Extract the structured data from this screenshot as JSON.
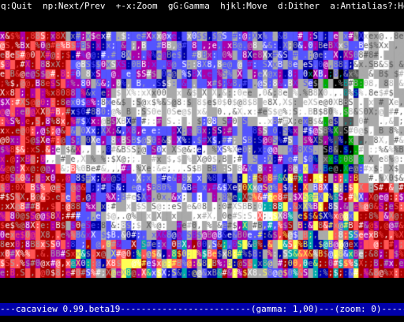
{
  "app": {
    "name": "cacaview"
  },
  "topbar": {
    "items": [
      {
        "key": "q",
        "label": "Quit"
      },
      {
        "key": "np",
        "label": "Next/Prev"
      },
      {
        "key": "+-x",
        "label": "Zoom"
      },
      {
        "key": "gG",
        "label": "Gamma"
      },
      {
        "key": "hjkl",
        "label": "Move"
      },
      {
        "key": "d",
        "label": "Dither"
      },
      {
        "key": "a",
        "label": "Antialias"
      },
      {
        "key": "?",
        "label": "Help"
      }
    ],
    "text": "q:Quit  np:Next/Prev  +-x:Zoom  gG:Gamma  hjkl:Move  d:Dither  a:Antialias?:Help"
  },
  "statusbar": {
    "text": "---cacaview 0.99.beta19-------------------------(gamma: 1,00)---(zoom: 0)-----"
  },
  "palette": {
    "white": "#ffffff",
    "light_gray": "#aaaaaa",
    "dark_gray": "#555555",
    "blue": "#0000aa",
    "light_blue": "#5555ff",
    "red": "#aa0000",
    "light_red": "#ff5555",
    "magenta": "#aa00aa",
    "light_magenta": "#ff55ff",
    "cyan": "#00aaaa",
    "yellow": "#ffff55",
    "green": "#00aa00",
    "black": "#000000"
  },
  "ascii_glyphs": "@8%#X$S&Bxe0;:.,"
}
